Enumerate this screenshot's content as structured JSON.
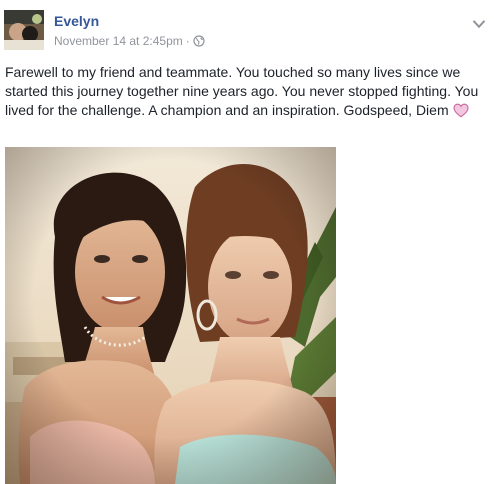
{
  "post": {
    "author": "Evelyn",
    "timestamp": "November 14 at 2:45pm",
    "separator": "·",
    "privacy_icon": "globe-icon",
    "menu_icon": "chevron-down-icon",
    "text": "Farewell to my friend and teammate. You touched so many lives since we started this journey together nine years ago. You never stopped fighting. You lived for the challenge. A champion and an inspiration. Godspeed, Diem",
    "emoji_icon": "heart-icon",
    "photo_icon": "photo-image",
    "colors": {
      "name": "#365899",
      "meta": "#90949c",
      "text": "#1d2129",
      "heart_fill": "#f3c6e0",
      "heart_stroke": "#c76a9d"
    }
  }
}
